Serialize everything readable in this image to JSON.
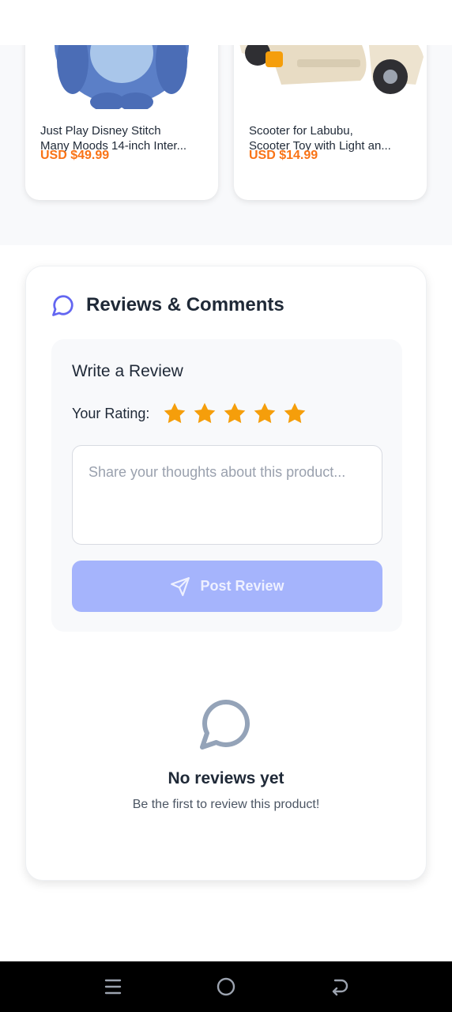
{
  "products": [
    {
      "name": "Just Play Disney Stitch\nMany Moods 14-inch Inter...",
      "price": "USD $49.99",
      "image_icon": "plush-toy-image"
    },
    {
      "name": "Scooter for Labubu,\nScooter Toy with Light an...",
      "price": "USD $14.99",
      "image_icon": "toy-scooter-image"
    }
  ],
  "reviews": {
    "title": "Reviews & Comments",
    "write": {
      "title": "Write a Review",
      "rating_label": "Your Rating:",
      "rating_value": 5,
      "rating_max": 5,
      "placeholder": "Share your thoughts about this product...",
      "post_label": "Post Review"
    },
    "empty": {
      "title": "No reviews yet",
      "subtitle": "Be the first to review this product!"
    }
  },
  "colors": {
    "price": "#f97316",
    "star": "#f59e0b",
    "post_button": "#a5b4fc",
    "accent_icon": "#6366f1"
  },
  "nav": {
    "icons": [
      "menu-icon",
      "home-icon",
      "back-icon"
    ]
  }
}
